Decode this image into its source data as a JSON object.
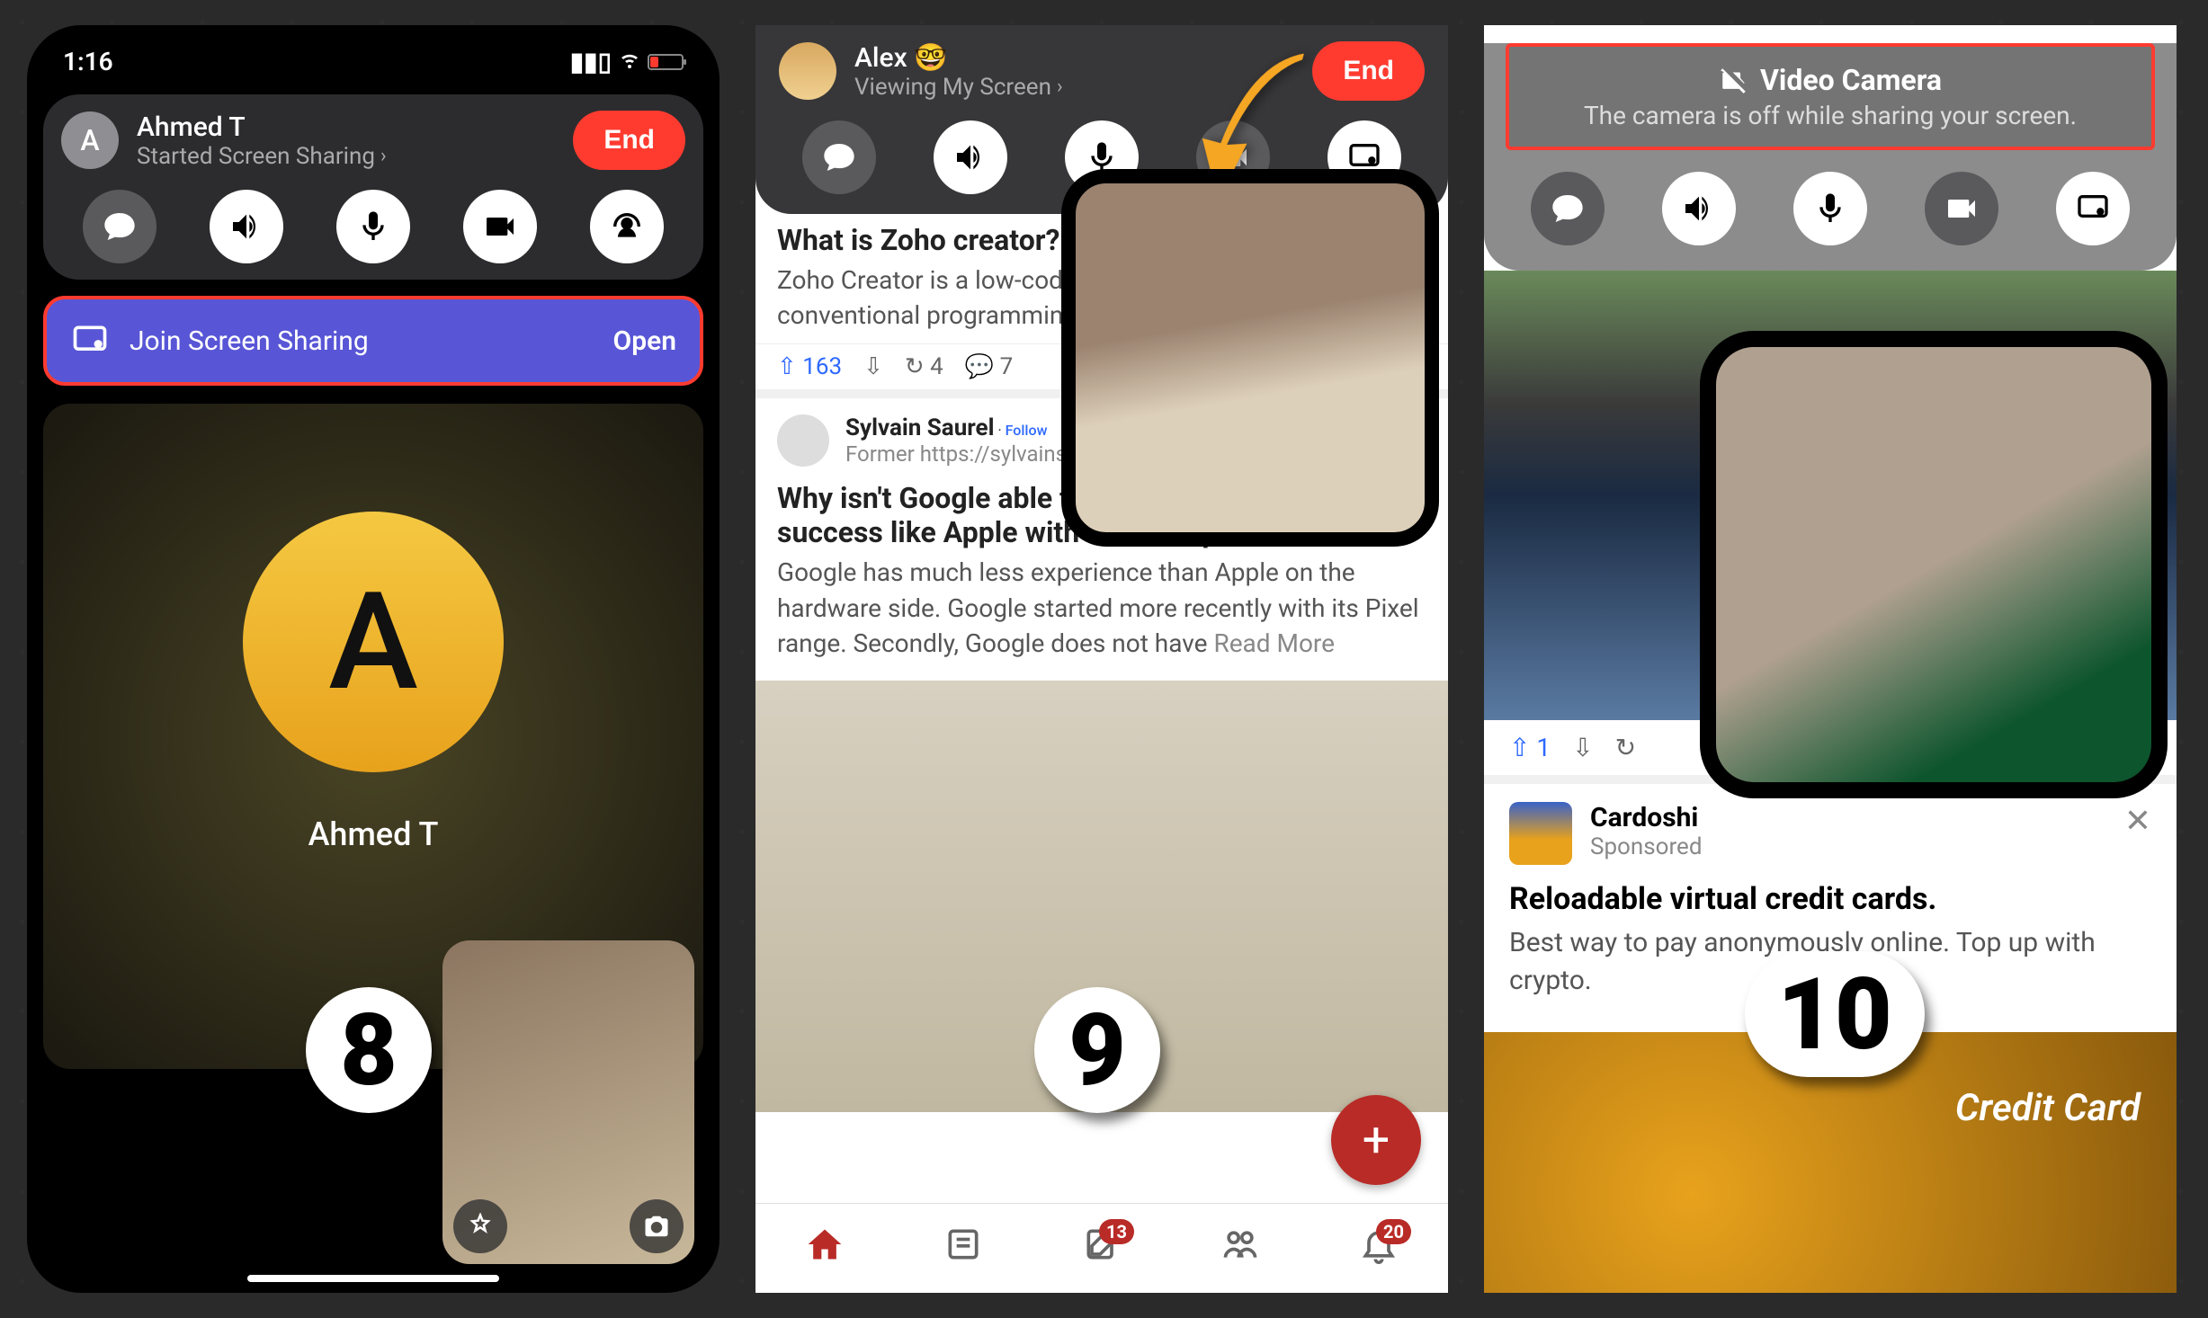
{
  "s1": {
    "time": "1:16",
    "caller": "Ahmed T",
    "status": "Started Screen Sharing",
    "end": "End",
    "join_label": "Join Screen Sharing",
    "open": "Open",
    "avatar_letter": "A",
    "video_name": "Ahmed T",
    "step": "8"
  },
  "s2": {
    "caller": "Alex 🤓",
    "status": "Viewing My Screen",
    "end": "End",
    "post1_title": "What is Zoho creator? How do I use it?",
    "post1_body": "Zoho Creator is a low-code platform. Low-code means conventional programming …",
    "upvotes": "163",
    "shares": "4",
    "comments": "7",
    "author": "Sylvain Saurel",
    "follow": "Follow",
    "author_meta": "Former https://sylvainsa…",
    "post2_title": "Why isn't Google able to reach the same level of success like Apple with its smartphones?",
    "post2_body": "Google has much less experience than Apple on the hardware side. Google started more recently with its Pixel range. Secondly, Google does not have",
    "read_more": "Read More",
    "badge_notif": "13",
    "badge_bell": "20",
    "step": "9"
  },
  "s3": {
    "toast_title": "Video Camera",
    "toast_sub": "The camera is off while sharing your screen.",
    "upvotes": "1",
    "ad_brand": "Cardoshi",
    "ad_sponsored": "Sponsored",
    "ad_headline": "Reloadable virtual credit cards.",
    "ad_body": "Best way to pay anonymously online. Top up with crypto.",
    "ad_card_text": "Credit Card",
    "step": "10"
  }
}
